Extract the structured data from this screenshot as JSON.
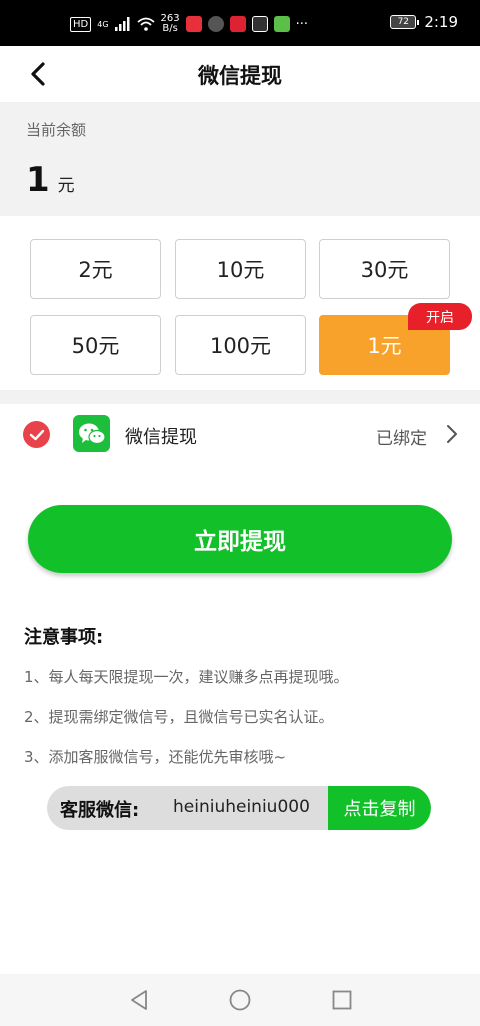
{
  "status_bar": {
    "network_hd": "HD",
    "network_type": "4G",
    "speed_value": "263",
    "speed_unit": "B/s",
    "more": "···",
    "battery": "72",
    "time": "2:19"
  },
  "header": {
    "title": "微信提现"
  },
  "balance": {
    "label": "当前余额",
    "amount": "1",
    "unit": "元"
  },
  "amount_options": [
    {
      "label": "2元",
      "selected": false
    },
    {
      "label": "10元",
      "selected": false
    },
    {
      "label": "30元",
      "selected": false
    },
    {
      "label": "50元",
      "selected": false
    },
    {
      "label": "100元",
      "selected": false
    },
    {
      "label": "1元",
      "selected": true
    }
  ],
  "badge": {
    "label": "开启"
  },
  "method": {
    "label": "微信提现",
    "status": "已绑定",
    "checked": true
  },
  "withdraw_button": {
    "label": "立即提现"
  },
  "notes": {
    "title": "注意事项:",
    "items": [
      "1、每人每天限提现一次，建议赚多点再提现哦。",
      "2、提现需绑定微信号，且微信号已实名认证。",
      "3、添加客服微信号，还能优先审核哦~"
    ]
  },
  "service": {
    "label": "客服微信:",
    "wechat_id": "heiniuheiniu000",
    "copy_label": "点击复制"
  },
  "colors": {
    "accent_green": "#12c02a",
    "selected_orange": "#f8a22b",
    "badge_red": "#e8202a",
    "check_red": "#e8424a"
  },
  "icons": [
    "back-arrow-icon",
    "check-circle-icon",
    "wechat-icon",
    "chevron-right-icon",
    "nav-back-icon",
    "nav-home-icon",
    "nav-recents-icon"
  ]
}
